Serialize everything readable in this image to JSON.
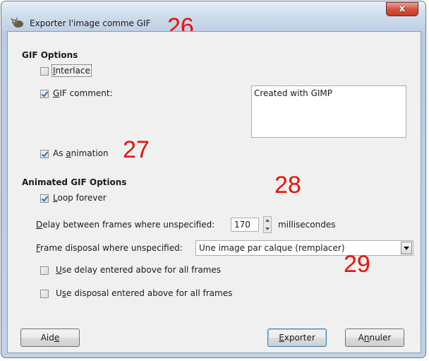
{
  "window": {
    "title": "Exporter l'image comme GIF",
    "icon": "gimp-wilber-icon",
    "close_label": "x"
  },
  "annotations": [
    "26",
    "27",
    "28",
    "29"
  ],
  "gif_options": {
    "title": "GIF Options",
    "interlace": {
      "label_u": "I",
      "label_rest": "nterlace",
      "checked": false
    },
    "gif_comment": {
      "label_u": "G",
      "label_rest": "IF comment:",
      "checked": true
    },
    "comment_text": "Created with GIMP",
    "as_animation": {
      "label_pre": "As ",
      "label_u": "a",
      "label_rest": "nimation",
      "checked": true
    }
  },
  "animated_options": {
    "title": "Animated GIF Options",
    "loop_forever": {
      "label_u": "L",
      "label_rest": "oop forever",
      "checked": true
    },
    "delay_label_u": "D",
    "delay_label_rest": "elay between frames where unspecified:",
    "delay_value": "170",
    "delay_unit": "millisecondes",
    "disposal_label_u": "F",
    "disposal_label_rest": "rame disposal where unspecified:",
    "disposal_value": "Une image par calque (remplacer)",
    "use_delay": {
      "label_u": "U",
      "label_rest": "se delay entered above for all frames",
      "checked": false
    },
    "use_disposal": {
      "label_pre": "U",
      "label_u": "s",
      "label_rest": "e disposal entered above for all frames",
      "checked": false
    }
  },
  "buttons": {
    "help_pre": "Aid",
    "help_u": "e",
    "export_u": "E",
    "export_rest": "xporter",
    "cancel_pre": "A",
    "cancel_u": "n",
    "cancel_rest": "nuler"
  }
}
